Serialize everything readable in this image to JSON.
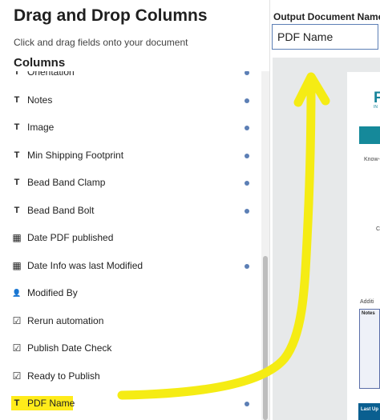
{
  "panel": {
    "title": "Drag and Drop Columns",
    "subtitle": "Click and drag fields onto your document",
    "columns_heading": "Columns"
  },
  "fields": [
    {
      "label": "Orientation",
      "type": "text-icon",
      "glyph": "T",
      "dot": true
    },
    {
      "label": "Notes",
      "type": "text-icon",
      "glyph": "T",
      "dot": true
    },
    {
      "label": "Image",
      "type": "text-icon",
      "glyph": "T",
      "dot": true
    },
    {
      "label": "Min Shipping Footprint",
      "type": "text-icon",
      "glyph": "T",
      "dot": true
    },
    {
      "label": "Bead Band Clamp",
      "type": "text-icon",
      "glyph": "T",
      "dot": true
    },
    {
      "label": "Bead Band Bolt",
      "type": "text-icon",
      "glyph": "T",
      "dot": true
    },
    {
      "label": "Date PDF published",
      "type": "calendar-icon",
      "glyph": "▦",
      "dot": false
    },
    {
      "label": "Date Info was last Modified",
      "type": "calendar-icon",
      "glyph": "▦",
      "dot": true
    },
    {
      "label": "Modified By",
      "type": "person-icon",
      "glyph": "👤",
      "dot": false
    },
    {
      "label": "Rerun automation",
      "type": "checkbox-icon",
      "glyph": "☑",
      "dot": false
    },
    {
      "label": "Publish Date Check",
      "type": "checkbox-icon",
      "glyph": "☑",
      "dot": false
    },
    {
      "label": "Ready to Publish",
      "type": "checkbox-icon",
      "glyph": "☑",
      "dot": false
    },
    {
      "label": "PDF Name",
      "type": "text-icon",
      "glyph": "T",
      "dot": true,
      "highlighted": true
    }
  ],
  "output": {
    "label": "Output Document Name",
    "value": "PDF Name"
  },
  "preview": {
    "logo": "F",
    "logo_sub": "IN",
    "know": "Know-",
    "c": "C",
    "addi": "Additi",
    "notes_label": "Notes",
    "last_updated": "Last Up"
  },
  "colors": {
    "accent": "#5c7fb5",
    "highlight": "#ffeb1a",
    "arrow": "#f5ec14",
    "teal": "#15899a",
    "footer_blue": "#0a5f90"
  }
}
